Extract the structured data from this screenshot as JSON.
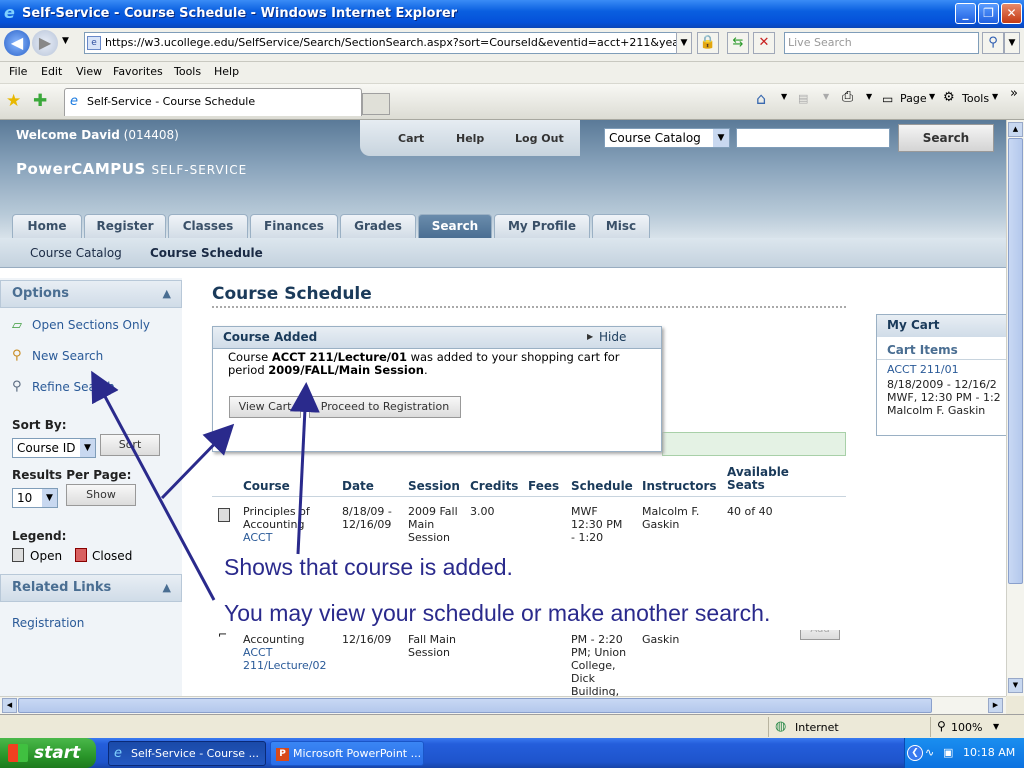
{
  "window": {
    "title": "Self-Service - Course Schedule - Windows Internet Explorer"
  },
  "browser": {
    "url": "https://w3.ucollege.edu/SelfService/Search/SectionSearch.aspx?sort=CourseId&eventid=acct+211&year=2009&tern",
    "live_search_placeholder": "Live Search",
    "menu": [
      "File",
      "Edit",
      "View",
      "Favorites",
      "Tools",
      "Help"
    ],
    "tab_title": "Self-Service - Course Schedule",
    "toolbar_page": "Page",
    "toolbar_tools": "Tools",
    "chevron": "»"
  },
  "header": {
    "welcome_prefix": "Welcome David",
    "welcome_id": "(014408)",
    "links": [
      "Cart",
      "Help",
      "Log Out"
    ],
    "search_select": "Course Catalog",
    "search_button": "Search",
    "brand_main": "PowerCAMPUS",
    "brand_sub": "SELF-SERVICE"
  },
  "nav": {
    "tabs": [
      "Home",
      "Register",
      "Classes",
      "Finances",
      "Grades",
      "Search",
      "My Profile",
      "Misc"
    ],
    "active": "Search",
    "subtabs": [
      "Course Catalog",
      "Course Schedule"
    ]
  },
  "sidebar": {
    "options_title": "Options",
    "links": [
      "Open Sections Only",
      "New Search",
      "Refine Search"
    ],
    "sort_label": "Sort By:",
    "sort_value": "Course ID",
    "sort_button": "Sort",
    "results_label": "Results Per Page:",
    "results_value": "10",
    "show_button": "Show",
    "legend_label": "Legend:",
    "legend_open": "Open",
    "legend_closed": "Closed",
    "related_title": "Related Links",
    "related_link": "Registration"
  },
  "main": {
    "title": "Course Schedule",
    "popup": {
      "title": "Course Added",
      "hide": "Hide",
      "text_1": "Course ",
      "course": "ACCT 211/Lecture/01",
      "text_2": " was added to your shopping cart for period ",
      "period": "2009/FALL/Main Session",
      "text_3": ".",
      "view_cart": "View Cart",
      "proceed": "Proceed to Registration"
    },
    "table": {
      "headers": [
        "Course",
        "Date",
        "Session",
        "Credits",
        "Fees",
        "Schedule",
        "Instructors",
        "Available Seats"
      ],
      "row1": {
        "course": "Principles of Accounting",
        "course_link": "ACCT",
        "date": "8/18/09 - 12/16/09",
        "session": "2009 Fall Main Session",
        "credits": "3.00",
        "schedule": "MWF 12:30 PM - 1:20",
        "instructors": "Malcolm F. Gaskin",
        "seats": "40 of 40"
      },
      "row2": {
        "course": "Accounting",
        "course_link": "ACCT 211/Lecture/02",
        "date": "12/16/09",
        "session": "Fall Main Session",
        "schedule": "PM - 2:20 PM; Union College, Dick Building,",
        "instructors": "Gaskin",
        "action": "Add"
      }
    }
  },
  "cart": {
    "title": "My Cart",
    "items_label": "Cart Items",
    "item_link": "ACCT 211/01",
    "item_dates": "8/18/2009 - 12/16/2",
    "item_time": "MWF, 12:30 PM - 1:2",
    "item_instructor": "Malcolm F. Gaskin"
  },
  "annotations": {
    "line1": "Shows that course is added.",
    "line2": "You may view your schedule or make another search."
  },
  "status": {
    "zone": "Internet",
    "zoom": "100%"
  },
  "taskbar": {
    "start": "start",
    "items": [
      "Self-Service - Course ...",
      "Microsoft PowerPoint ..."
    ],
    "time": "10:18 AM"
  }
}
